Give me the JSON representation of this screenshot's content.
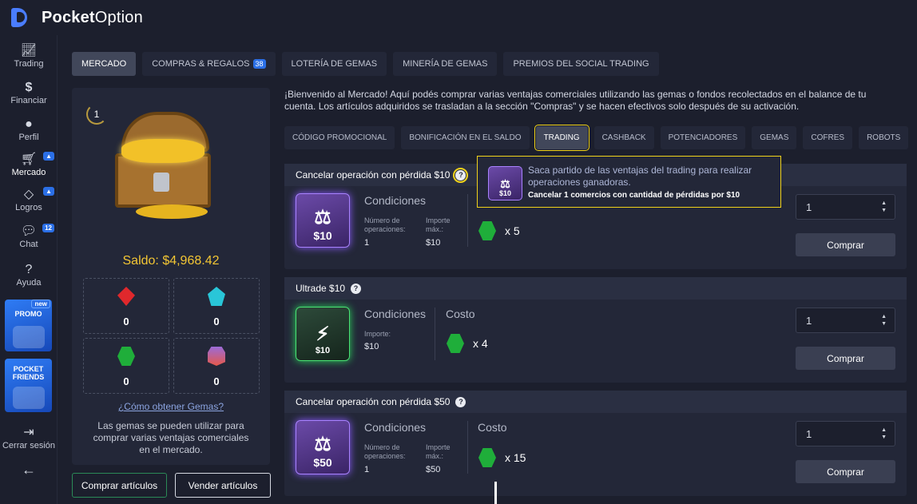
{
  "brand": {
    "name_bold": "Pocket",
    "name_light": "Option"
  },
  "nav": {
    "trading": "Trading",
    "financiar": "Financiar",
    "perfil": "Perfil",
    "mercado": "Mercado",
    "logros": "Logros",
    "chat": "Chat",
    "chat_badge": "12",
    "ayuda": "Ayuda",
    "promo_label": "PROMO",
    "promo_new": "new",
    "pocket_friends": "POCKET FRIENDS",
    "logout": "Cerrar sesión",
    "back": "←"
  },
  "tabs": {
    "mercado": "MERCADO",
    "compras": "COMPRAS & REGALOS",
    "compras_count": "38",
    "loteria": "LOTERÍA DE GEMAS",
    "mineria": "MINERÍA DE GEMAS",
    "premios": "PREMIOS DEL SOCIAL TRADING"
  },
  "left_panel": {
    "level": "1",
    "saldo": "Saldo: $4,968.42",
    "gems": {
      "red": "0",
      "cyan": "0",
      "green": "0",
      "purple": "0"
    },
    "how_link": "¿Cómo obtener Gemas?",
    "description": "Las gemas se pueden utilizar para comprar varias ventajas comerciales en el mercado.",
    "buy_button": "Comprar artículos",
    "sell_button": "Vender artículos"
  },
  "intro": "¡Bienvenido al Mercado! Aquí podés comprar varias ventajas comerciales utilizando las gemas o fondos recolectados en el balance de tu cuenta. Los artículos adquiridos se trasladan a la sección \"Compras\" y se hacen efectivos solo después de su activación.",
  "subtabs": {
    "promo": "CÓDIGO PROMOCIONAL",
    "bonus": "BONIFICACIÓN EN EL SALDO",
    "trading": "TRADING",
    "cashback": "CASHBACK",
    "potenciadores": "POTENCIADORES",
    "gemas": "GEMAS",
    "cofres": "COFRES",
    "robots": "ROBOTS"
  },
  "products": [
    {
      "title": "Cancelar operación con pérdida $10",
      "thumb_price": "$10",
      "conditions": "Condiciones",
      "num_label": "Número de operaciones:",
      "num_value": "1",
      "max_label": "Importe máx.:",
      "max_value": "$10",
      "cost_mult": "x 5",
      "qty": "1",
      "buy": "Comprar"
    },
    {
      "title": "Ultrade $10",
      "thumb_price": "$10",
      "conditions": "Condiciones",
      "amount_label": "Importe:",
      "amount_value": "$10",
      "cost_title": "Costo",
      "cost_mult": "x 4",
      "qty": "1",
      "buy": "Comprar"
    },
    {
      "title": "Cancelar operación con pérdida $50",
      "thumb_price": "$50",
      "conditions": "Condiciones",
      "num_label": "Número de operaciones:",
      "num_value": "1",
      "max_label": "Importe máx.:",
      "max_value": "$50",
      "cost_title": "Costo",
      "cost_mult": "x 15",
      "qty": "1",
      "buy": "Comprar"
    }
  ],
  "tooltip": {
    "icon_price": "$10",
    "text": "Saca partido de las ventajas del trading para realizar operaciones ganadoras.",
    "sub": "Cancelar 1 comercios con cantidad de pérdidas por $10"
  },
  "colors": {
    "accent": "#2b6fe6",
    "highlight": "#f0d21a",
    "saldo": "#f3c634",
    "gem_green": "#1fae3a"
  }
}
